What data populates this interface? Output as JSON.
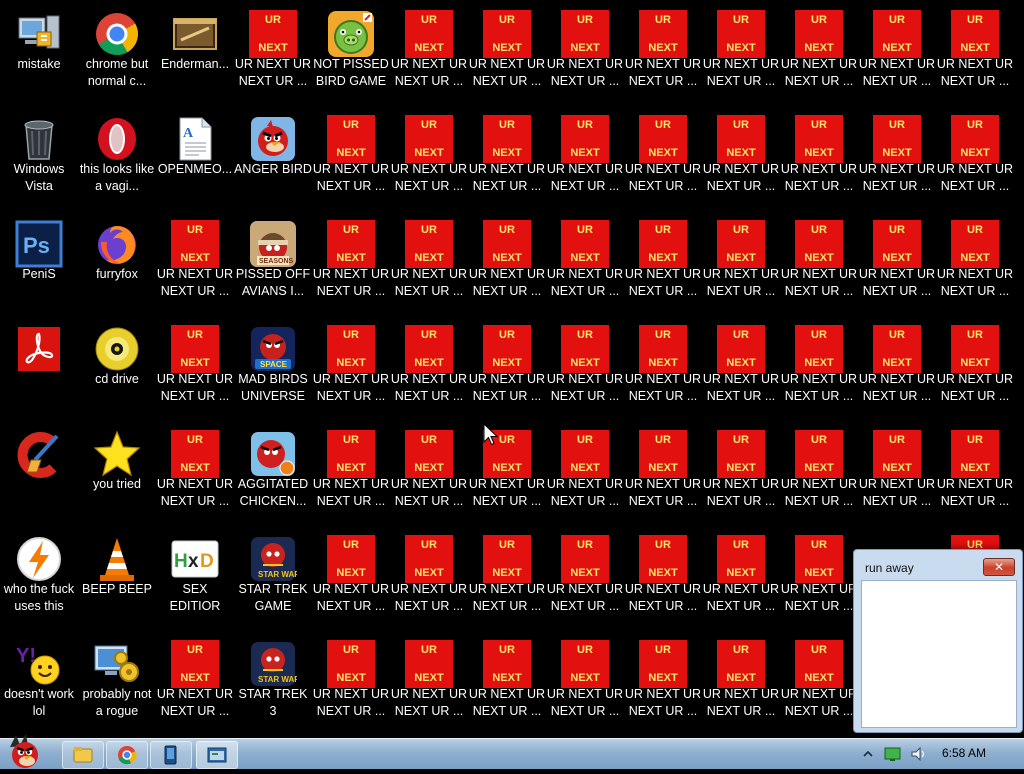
{
  "desktop": {
    "icons": [
      {
        "col": 0,
        "row": 0,
        "label": "mistake",
        "icon": "computer-icon"
      },
      {
        "col": 1,
        "row": 0,
        "label": "chrome but normal c...",
        "icon": "chrome-icon"
      },
      {
        "col": 2,
        "row": 0,
        "label": "Enderman...",
        "icon": "window-folder-icon"
      },
      {
        "col": 4,
        "row": 0,
        "label": "NOT PISSED BIRD GAME",
        "icon": "green-pig-icon"
      },
      {
        "col": 0,
        "row": 1,
        "label": "Windows Vista",
        "icon": "recycle-bin-icon"
      },
      {
        "col": 1,
        "row": 1,
        "label": "this looks like a vagi...",
        "icon": "opera-icon"
      },
      {
        "col": 2,
        "row": 1,
        "label": "OPENMEO...",
        "icon": "document-icon"
      },
      {
        "col": 3,
        "row": 1,
        "label": "ANGER BIRD",
        "icon": "red-bird-icon"
      },
      {
        "col": 0,
        "row": 2,
        "label": "PeniS",
        "icon": "photoshop-icon"
      },
      {
        "col": 1,
        "row": 2,
        "label": "furryfox",
        "icon": "firefox-icon"
      },
      {
        "col": 3,
        "row": 2,
        "label": "PISSED OFF AVIANS I...",
        "icon": "seasons-bird-icon"
      },
      {
        "col": 0,
        "row": 3,
        "label": "",
        "icon": "acrobat-icon"
      },
      {
        "col": 1,
        "row": 3,
        "label": "cd drive",
        "icon": "cd-icon"
      },
      {
        "col": 3,
        "row": 3,
        "label": "MAD BIRDS UNIVERSE",
        "icon": "space-bird-icon"
      },
      {
        "col": 0,
        "row": 4,
        "label": "",
        "icon": "ccleaner-icon"
      },
      {
        "col": 1,
        "row": 4,
        "label": "you tried",
        "icon": "star-icon"
      },
      {
        "col": 3,
        "row": 4,
        "label": "AGGITATED CHICKEN...",
        "icon": "rio-bird-icon"
      },
      {
        "col": 0,
        "row": 5,
        "label": "who the fuck uses this",
        "icon": "lightning-icon"
      },
      {
        "col": 1,
        "row": 5,
        "label": "BEEP BEEP",
        "icon": "traffic-cone-icon"
      },
      {
        "col": 2,
        "row": 5,
        "label": "SEX EDITIOR",
        "icon": "hxd-icon"
      },
      {
        "col": 3,
        "row": 5,
        "label": "STAR TREK GAME",
        "icon": "starwars-bird-icon"
      },
      {
        "col": 0,
        "row": 6,
        "label": "doesn't work lol",
        "icon": "yahoo-icon"
      },
      {
        "col": 1,
        "row": 6,
        "label": "probably not a rogue",
        "icon": "monitor-gears-icon"
      },
      {
        "col": 3,
        "row": 6,
        "label": "STAR TREK 3",
        "icon": "starwars-bird-icon"
      }
    ],
    "ur_tile": {
      "top_text": "UR",
      "bottom_text": "NEXT",
      "label": "UR NEXT UR NEXT UR ...",
      "narrow_label": "UR NEXT UR NEXT UR ...",
      "fill": "#e31010",
      "text_color": "#fbe36a"
    },
    "ur_tiles": [
      {
        "col": 3,
        "row": 0
      },
      {
        "col": 5,
        "row": 0
      },
      {
        "col": 6,
        "row": 0
      },
      {
        "col": 7,
        "row": 0
      },
      {
        "col": 8,
        "row": 0
      },
      {
        "col": 9,
        "row": 0
      },
      {
        "col": 10,
        "row": 0
      },
      {
        "col": 11,
        "row": 0
      },
      {
        "col": 12,
        "row": 0
      },
      {
        "col": 4,
        "row": 1
      },
      {
        "col": 5,
        "row": 1
      },
      {
        "col": 6,
        "row": 1
      },
      {
        "col": 7,
        "row": 1
      },
      {
        "col": 8,
        "row": 1
      },
      {
        "col": 9,
        "row": 1
      },
      {
        "col": 10,
        "row": 1
      },
      {
        "col": 11,
        "row": 1
      },
      {
        "col": 12,
        "row": 1
      },
      {
        "col": 2,
        "row": 2
      },
      {
        "col": 4,
        "row": 2
      },
      {
        "col": 5,
        "row": 2
      },
      {
        "col": 6,
        "row": 2
      },
      {
        "col": 7,
        "row": 2
      },
      {
        "col": 8,
        "row": 2
      },
      {
        "col": 9,
        "row": 2
      },
      {
        "col": 10,
        "row": 2
      },
      {
        "col": 11,
        "row": 2
      },
      {
        "col": 12,
        "row": 2
      },
      {
        "col": 2,
        "row": 3
      },
      {
        "col": 4,
        "row": 3
      },
      {
        "col": 5,
        "row": 3
      },
      {
        "col": 6,
        "row": 3
      },
      {
        "col": 7,
        "row": 3
      },
      {
        "col": 8,
        "row": 3
      },
      {
        "col": 9,
        "row": 3
      },
      {
        "col": 10,
        "row": 3
      },
      {
        "col": 11,
        "row": 3
      },
      {
        "col": 12,
        "row": 3
      },
      {
        "col": 2,
        "row": 4
      },
      {
        "col": 4,
        "row": 4
      },
      {
        "col": 5,
        "row": 4
      },
      {
        "col": 6,
        "row": 4
      },
      {
        "col": 7,
        "row": 4
      },
      {
        "col": 8,
        "row": 4
      },
      {
        "col": 9,
        "row": 4
      },
      {
        "col": 10,
        "row": 4
      },
      {
        "col": 11,
        "row": 4
      },
      {
        "col": 12,
        "row": 4
      },
      {
        "col": 4,
        "row": 5
      },
      {
        "col": 5,
        "row": 5
      },
      {
        "col": 6,
        "row": 5
      },
      {
        "col": 7,
        "row": 5
      },
      {
        "col": 8,
        "row": 5
      },
      {
        "col": 9,
        "row": 5
      },
      {
        "col": 10,
        "row": 5
      },
      {
        "col": 12,
        "row": 5
      },
      {
        "col": 2,
        "row": 6
      },
      {
        "col": 4,
        "row": 6
      },
      {
        "col": 5,
        "row": 6
      },
      {
        "col": 6,
        "row": 6
      },
      {
        "col": 7,
        "row": 6
      },
      {
        "col": 8,
        "row": 6
      },
      {
        "col": 9,
        "row": 6
      },
      {
        "col": 10,
        "row": 6
      }
    ]
  },
  "window": {
    "title": "run away",
    "close_label": "✕"
  },
  "taskbar": {
    "start_icon": "angry-bird-start-icon",
    "pinned": [
      {
        "name": "explorer-taskbar-button",
        "icon": "folder-icon"
      },
      {
        "name": "chrome-taskbar-button",
        "icon": "chrome-icon"
      },
      {
        "name": "phone-app-taskbar-button",
        "icon": "phone-icon"
      },
      {
        "name": "running-window-taskbar-button",
        "icon": "window-app-icon"
      }
    ],
    "tray_icons": [
      "show-hidden-icons-chevron-icon",
      "network-icon",
      "volume-icon"
    ],
    "clock": "6:58 AM"
  }
}
